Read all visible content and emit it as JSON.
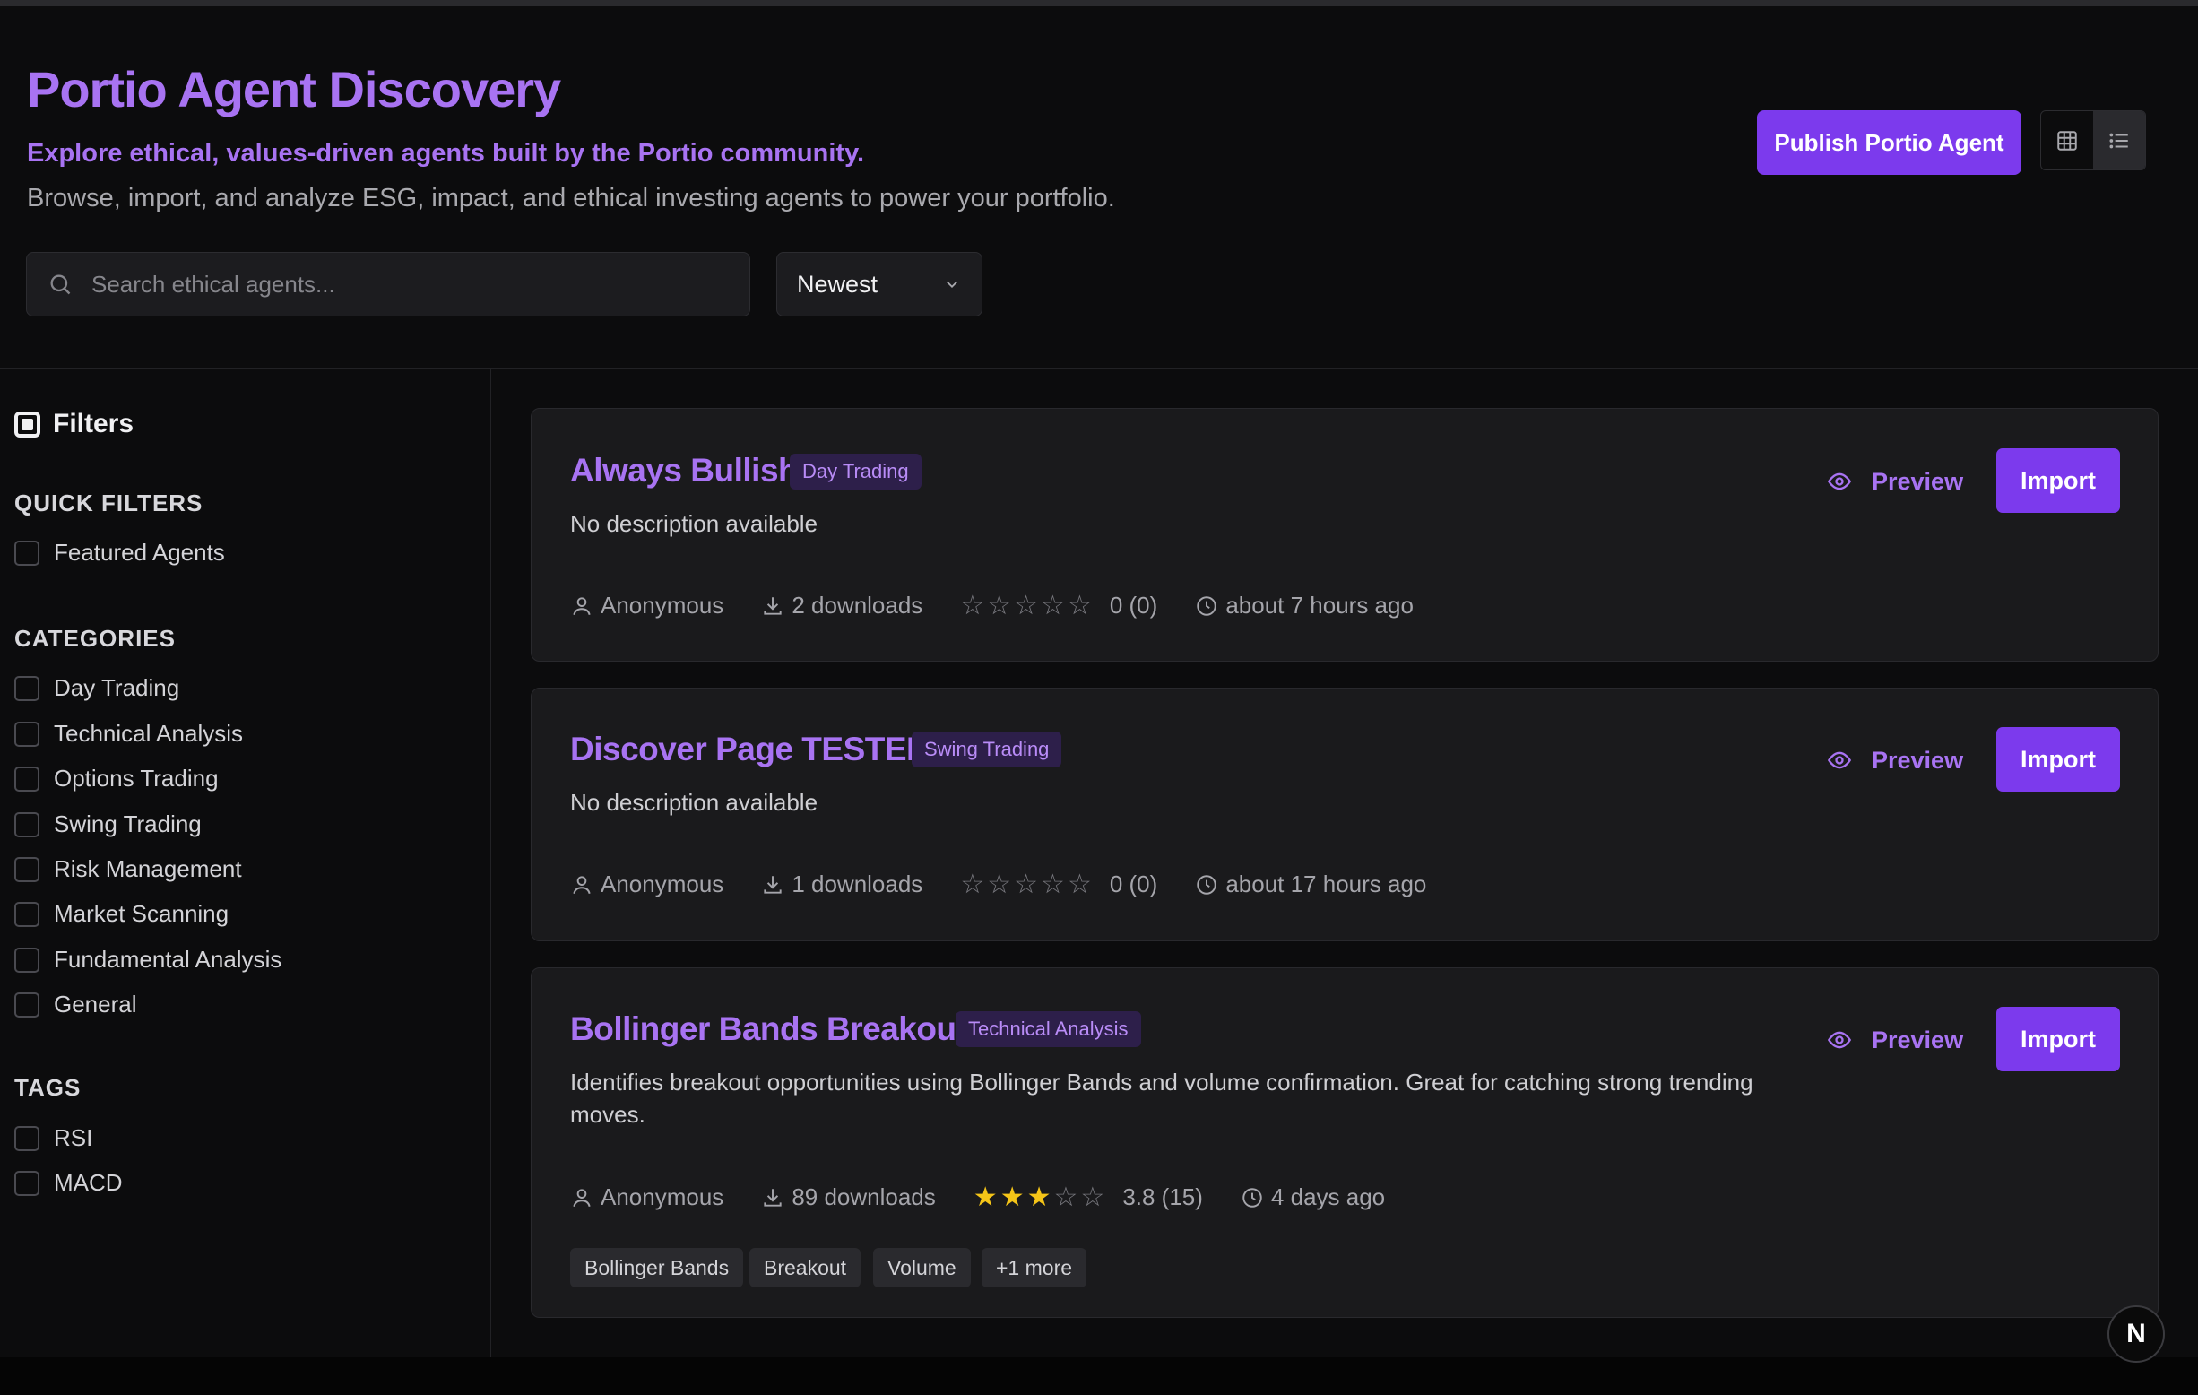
{
  "header": {
    "title": "Portio Agent Discovery",
    "subtitle": "Explore ethical, values-driven agents built by the Portio community.",
    "description": "Browse, import, and analyze ESG, impact, and ethical investing agents to power your portfolio.",
    "publish_label": "Publish Portio Agent",
    "view_modes": [
      "grid-view-icon",
      "list-view-icon"
    ],
    "active_view": "list"
  },
  "search": {
    "placeholder": "Search ethical agents...",
    "value": ""
  },
  "sort": {
    "selected": "Newest"
  },
  "sidebar": {
    "title": "Filters",
    "quick_filters_title": "QUICK FILTERS",
    "quick_filters": [
      {
        "label": "Featured Agents",
        "checked": false
      }
    ],
    "categories_title": "CATEGORIES",
    "categories": [
      {
        "label": "Day Trading",
        "checked": false
      },
      {
        "label": "Technical Analysis",
        "checked": false
      },
      {
        "label": "Options Trading",
        "checked": false
      },
      {
        "label": "Swing Trading",
        "checked": false
      },
      {
        "label": "Risk Management",
        "checked": false
      },
      {
        "label": "Market Scanning",
        "checked": false
      },
      {
        "label": "Fundamental Analysis",
        "checked": false
      },
      {
        "label": "General",
        "checked": false
      }
    ],
    "tags_title": "TAGS",
    "tags": [
      {
        "label": "RSI",
        "checked": false
      },
      {
        "label": "MACD",
        "checked": false
      }
    ]
  },
  "agents": [
    {
      "name": "Always Bullish",
      "category": "Day Trading",
      "description": "No description available",
      "author": "Anonymous",
      "downloads": "2 downloads",
      "rating": 0,
      "rating_text": "0 (0)",
      "time": "about 7 hours ago",
      "tags": []
    },
    {
      "name": "Discover Page TESTER",
      "category": "Swing Trading",
      "description": "No description available",
      "author": "Anonymous",
      "downloads": "1 downloads",
      "rating": 0,
      "rating_text": "0 (0)",
      "time": "about 17 hours ago",
      "tags": []
    },
    {
      "name": "Bollinger Bands Breakout",
      "category": "Technical Analysis",
      "description": "Identifies breakout opportunities using Bollinger Bands and volume confirmation. Great for catching strong trending moves.",
      "author": "Anonymous",
      "downloads": "89 downloads",
      "rating": 3.8,
      "rating_text": "3.8 (15)",
      "time": "4 days ago",
      "tags": [
        "Bollinger Bands",
        "Breakout",
        "Volume",
        "+1 more"
      ]
    }
  ],
  "actions": {
    "preview_label": "Preview",
    "import_label": "Import"
  },
  "colors": {
    "accent": "#7c3aed",
    "accent_text": "#a873f2",
    "background": "#0c0c0d",
    "card": "#1a1a1c",
    "star": "#f5c518"
  },
  "badge": {
    "letter": "N"
  }
}
